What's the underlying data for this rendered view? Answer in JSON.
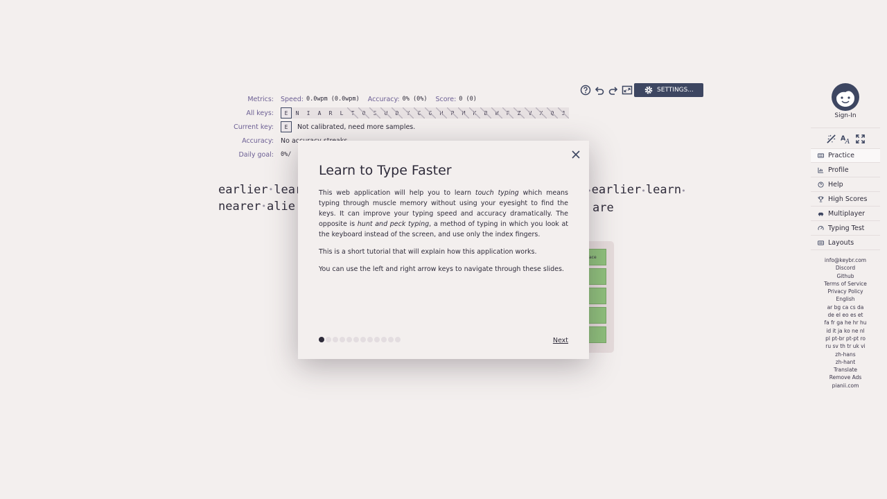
{
  "toolbar": {
    "icons": [
      "help-circle-icon",
      "undo-icon",
      "redo-icon",
      "fullscreen-icon"
    ],
    "settings_label": "SETTINGS..."
  },
  "metrics": {
    "metrics_label": "Metrics:",
    "speed_label": "Speed:",
    "speed_value": "0.0wpm (0.0wpm)",
    "accuracy_label": "Accuracy:",
    "accuracy_value": "0% (0%)",
    "score_label": "Score:",
    "score_value": "0 (0)",
    "all_keys_label": "All keys:",
    "all_keys": [
      "E",
      "N",
      "I",
      "A",
      "R",
      "L",
      "T",
      "O",
      "S",
      "U",
      "D",
      "Y",
      "C",
      "G",
      "H",
      "P",
      "M",
      "K",
      "B",
      "W",
      "F",
      "Z",
      "V",
      "X",
      "Q",
      "J"
    ],
    "current_key_label": "Current key:",
    "current_key": "E",
    "current_key_status": "Not calibrated, need more samples.",
    "accuracy_row_label": "Accuracy:",
    "accuracy_row_value": "No accuracy streaks",
    "daily_goal_label": "Daily goal:",
    "daily_goal_value": "0%/"
  },
  "board": {
    "line1_left": [
      "earlier",
      "lear"
    ],
    "line1_right": [
      "earlier",
      "learn"
    ],
    "line2_left": [
      "nearer",
      "alie"
    ],
    "line2_right": "are"
  },
  "keyboard_peek": {
    "label": "ace"
  },
  "modal": {
    "title": "Learn to Type Faster",
    "p1_a": "This web application will help you to learn ",
    "p1_em1": "touch typing",
    "p1_b": " which means typing through muscle memory without using your eyesight to find the keys. It can improve your typing speed and accuracy dramatically. The opposite is ",
    "p1_em2": "hunt and peck typing",
    "p1_c": ", a method of typing in which you look at the keyboard instead of the screen, and use only the index fingers.",
    "p2": "This is a short tutorial that will explain how this application works.",
    "p3": "You can use the left and right arrow keys to navigate through these slides.",
    "pages_total": 12,
    "page_current": 1,
    "next_label": "Next"
  },
  "sidebar": {
    "signin_label": "Sign-In",
    "nav": [
      {
        "label": "Practice",
        "icon": "keyboard-icon"
      },
      {
        "label": "Profile",
        "icon": "chart-icon"
      },
      {
        "label": "Help",
        "icon": "help-icon"
      },
      {
        "label": "High Scores",
        "icon": "trophy-icon"
      },
      {
        "label": "Multiplayer",
        "icon": "car-icon"
      },
      {
        "label": "Typing Test",
        "icon": "gauge-icon"
      },
      {
        "label": "Layouts",
        "icon": "keyboard-icon"
      }
    ],
    "footer": [
      "info@keybr.com",
      "Discord",
      "Github",
      "Terms of Service",
      "Privacy Policy",
      "English",
      "ar bg ca cs da",
      "de el eo es et",
      "fa fr ga he hr hu",
      "id it ja ko ne nl",
      "pl pt-br pt-pt ro",
      "ru sv th tr uk vi",
      "zh-hans",
      "zh-hant",
      "Translate",
      "Remove Ads",
      "pianii.com"
    ]
  }
}
